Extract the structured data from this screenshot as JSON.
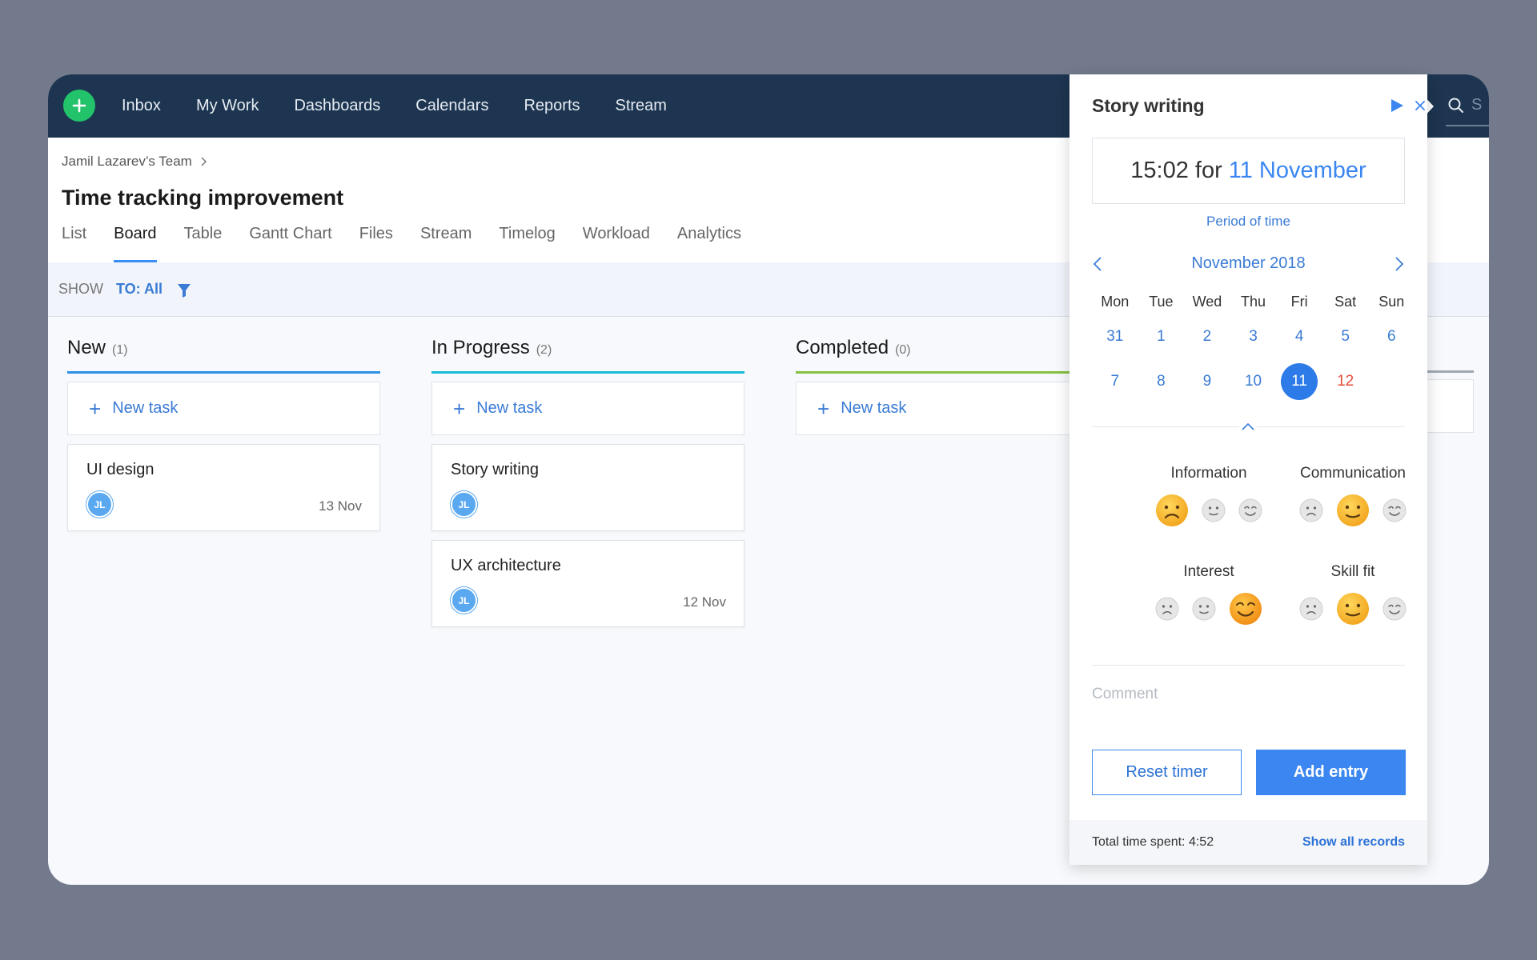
{
  "nav": {
    "items": [
      "Inbox",
      "My Work",
      "Dashboards",
      "Calendars",
      "Reports",
      "Stream"
    ],
    "search_placeholder": "S"
  },
  "header": {
    "breadcrumb": "Jamil Lazarev’s Team",
    "title": "Time tracking improvement",
    "tabs": [
      "List",
      "Board",
      "Table",
      "Gantt Chart",
      "Files",
      "Stream",
      "Timelog",
      "Workload",
      "Analytics"
    ],
    "active_tab": "Board"
  },
  "filter": {
    "show_label": "SHOW",
    "to_value": "TO: All"
  },
  "board": {
    "new_task_label": "New task",
    "columns": [
      {
        "title": "New",
        "count": "(1)",
        "color": "#2f8ee6",
        "cards": [
          {
            "title": "UI design",
            "avatar": "JL",
            "date": "13 Nov"
          }
        ]
      },
      {
        "title": "In Progress",
        "count": "(2)",
        "color": "#19bcd6",
        "cards": [
          {
            "title": "Story writing",
            "avatar": "JL",
            "date": ""
          },
          {
            "title": "UX architecture",
            "avatar": "JL",
            "date": "12 Nov"
          }
        ]
      },
      {
        "title": "Completed",
        "count": "(0)",
        "color": "#86c142",
        "cards": []
      }
    ]
  },
  "panel": {
    "title": "Story writing",
    "time": "15:02 for",
    "date": "11 November",
    "period_link": "Period of time",
    "calendar": {
      "month": "November 2018",
      "weekdays": [
        "Mon",
        "Tue",
        "Wed",
        "Thu",
        "Fri",
        "Sat",
        "Sun"
      ],
      "weeks": [
        [
          "31",
          "1",
          "2",
          "3",
          "4",
          "5",
          "6"
        ],
        [
          "7",
          "8",
          "9",
          "10",
          "11",
          "12",
          ""
        ]
      ],
      "selected": "11",
      "today": "12"
    },
    "moods": [
      {
        "label": "Information",
        "selected": "sad"
      },
      {
        "label": "Communication",
        "selected": "neutral"
      },
      {
        "label": "Interest",
        "selected": "happy"
      },
      {
        "label": "Skill fit",
        "selected": "neutral"
      }
    ],
    "comment_placeholder": "Comment",
    "reset_label": "Reset timer",
    "add_label": "Add entry",
    "total": "Total time spent: 4:52",
    "show_all": "Show all records"
  },
  "colors": {
    "topbar": "#1d3550",
    "accent": "#3b86f0",
    "add_green": "#22c36b",
    "today_red": "#e44b3a"
  }
}
